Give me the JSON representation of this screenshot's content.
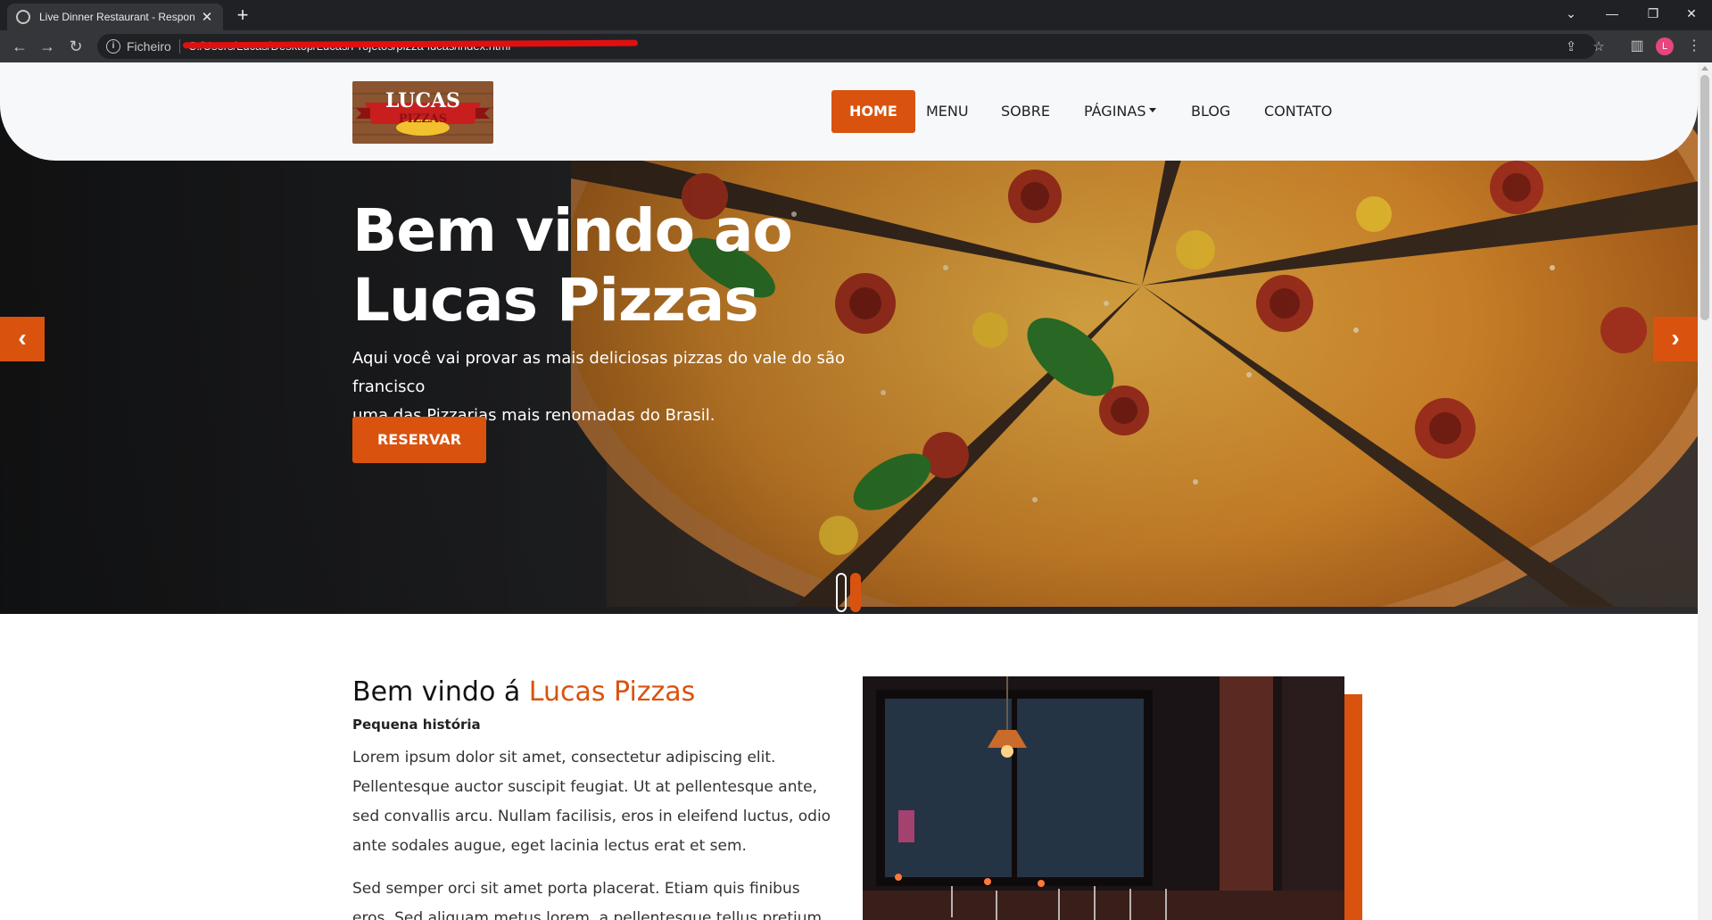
{
  "browser": {
    "tab_title": "Live Dinner Restaurant - Responsive",
    "tab_close": "✕",
    "new_tab": "+",
    "url_label": "Ficheiro",
    "url": "C:/Users/Lucas/Desktop/Lucas/Projetos/pizza-lucas/index.html",
    "profile_initial": "L"
  },
  "site": {
    "logo": {
      "line1": "LUCAS",
      "line2": "PIZZAS"
    },
    "nav": [
      {
        "label": "HOME",
        "active": true
      },
      {
        "label": "MENU"
      },
      {
        "label": "SOBRE"
      },
      {
        "label": "PÁGINAS",
        "dropdown": true
      },
      {
        "label": "BLOG"
      },
      {
        "label": "CONTATO"
      }
    ],
    "hero": {
      "title_line1": "Bem vindo ao",
      "title_line2": "Lucas Pizzas",
      "text_line1": "Aqui você vai provar as mais deliciosas pizzas do vale do são francisco",
      "text_line2": "uma das Pizzarias mais renomadas do Brasil.",
      "button": "RESERVAR",
      "prev_icon": "‹",
      "next_icon": "›"
    },
    "about": {
      "title_prefix": "Bem vindo á ",
      "title_accent": "Lucas Pizzas",
      "subtitle": "Pequena história",
      "p1": "Lorem ipsum dolor sit amet, consectetur adipiscing elit. Pellentesque auctor suscipit feugiat. Ut at pellentesque ante, sed convallis arcu. Nullam facilisis, eros in eleifend luctus, odio ante sodales augue, eget lacinia lectus erat et sem.",
      "p2": "Sed semper orci sit amet porta placerat. Etiam quis finibus eros. Sed aliquam metus lorem, a pellentesque tellus pretium a. Nulla"
    }
  },
  "colors": {
    "accent": "#d9530f",
    "header_bg": "#f7f8f9",
    "chrome_dark": "#202124"
  },
  "icons": [
    "globe-icon",
    "close-icon",
    "plus-icon",
    "back-icon",
    "forward-icon",
    "reload-icon",
    "info-icon",
    "share-icon",
    "star-icon",
    "sidepanel-icon",
    "menu-dots-icon",
    "chevron-left-icon",
    "chevron-right-icon"
  ]
}
